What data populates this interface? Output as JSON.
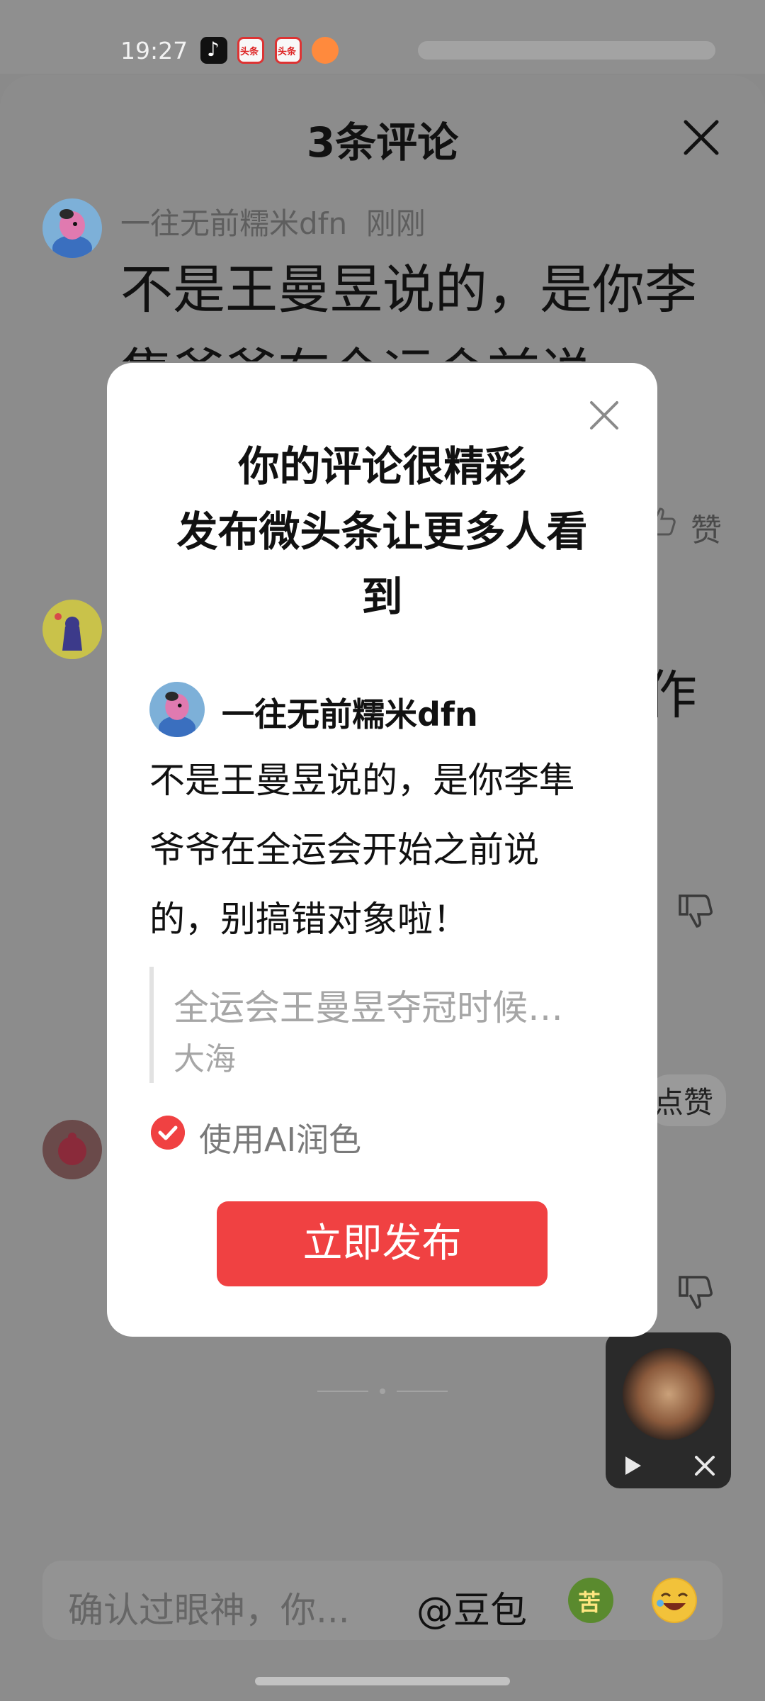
{
  "status_bar": {
    "time": "19:27",
    "apps": [
      "tiktok-icon",
      "toutiao-icon",
      "toutiao-icon",
      "app-icon"
    ]
  },
  "sheet": {
    "title": "3条评论",
    "first_comment": {
      "user": "一往无前糯米dfn",
      "time": "刚刚",
      "text": "不是王曼昱说的，是你李隼爷爷在全运会前说"
    },
    "like_label": "赞",
    "fragment_char": "作",
    "like_label_2": "点赞"
  },
  "input_bar": {
    "placeholder": "确认过眼神，你...",
    "at_label": "@豆包"
  },
  "modal": {
    "title_line1": "你的评论很精彩",
    "title_line2": "发布微头条让更多人看",
    "title_line3": "到",
    "user": "一往无前糯米dfn",
    "comment": "不是王曼昱说的，是你李隼爷爷在全运会开始之前说的，别搞错对象啦！",
    "quote_title": "全运会王曼昱夺冠时候…",
    "quote_author": "大海",
    "ai_option": "使用AI润色",
    "ai_checked": true,
    "publish_button": "立即发布"
  },
  "colors": {
    "accent": "#f04142",
    "overlay": "#8a8a8a",
    "modal_bg": "#ffffff"
  }
}
